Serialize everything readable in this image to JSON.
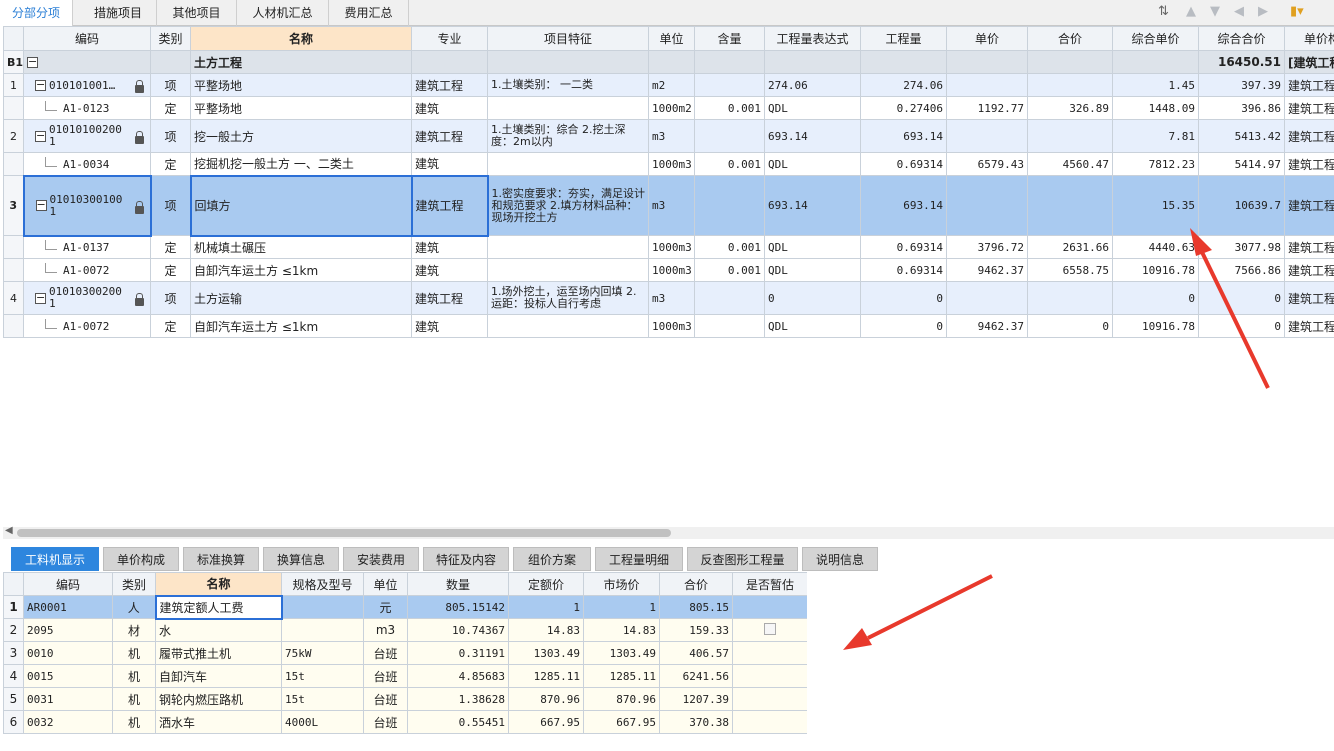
{
  "top_tabs": [
    "分部分项",
    "措施项目",
    "其他项目",
    "人材机汇总",
    "费用汇总"
  ],
  "main_headers": [
    "编码",
    "类别",
    "名称",
    "专业",
    "项目特征",
    "单位",
    "含量",
    "工程量表达式",
    "工程量",
    "单价",
    "合价",
    "综合单价",
    "综合合价",
    "单价构成文"
  ],
  "group_row": {
    "idx": "B1",
    "name": "土方工程",
    "total": "16450.51",
    "spec": "[建筑工程"
  },
  "rows": [
    {
      "type": "item",
      "idx": "1",
      "code": "010101001…",
      "cat": "项",
      "name": "平整场地",
      "major": "建筑工程",
      "feature": "1.土壤类别： 一二类",
      "unit": "m2",
      "content": "",
      "expr": "274.06",
      "qty": "274.06",
      "price": "",
      "sum": "",
      "uprice": "1.45",
      "utotal": "397.39",
      "comp": "建筑工程"
    },
    {
      "type": "sub",
      "idx": "",
      "code": "A1-0123",
      "cat": "定",
      "name": "平整场地",
      "major": "建筑",
      "feature": "",
      "unit": "1000m2",
      "content": "0.001",
      "expr": "QDL",
      "qty": "0.27406",
      "price": "1192.77",
      "sum": "326.89",
      "uprice": "1448.09",
      "utotal": "396.86",
      "comp": "建筑工程"
    },
    {
      "type": "item",
      "idx": "2",
      "code": "01010100200 1",
      "cat": "项",
      "name": "挖一般土方",
      "major": "建筑工程",
      "feature": "1.土壤类别：综合 2.挖土深度：2m以内",
      "unit": "m3",
      "content": "",
      "expr": "693.14",
      "qty": "693.14",
      "price": "",
      "sum": "",
      "uprice": "7.81",
      "utotal": "5413.42",
      "comp": "建筑工程"
    },
    {
      "type": "sub",
      "idx": "",
      "code": "A1-0034",
      "cat": "定",
      "name": "挖掘机挖一般土方 一、二类土",
      "major": "建筑",
      "feature": "",
      "unit": "1000m3",
      "content": "0.001",
      "expr": "QDL",
      "qty": "0.69314",
      "price": "6579.43",
      "sum": "4560.47",
      "uprice": "7812.23",
      "utotal": "5414.97",
      "comp": "建筑工程"
    },
    {
      "type": "sel",
      "idx": "3",
      "code": "01010300100 1",
      "cat": "项",
      "name": "回填方",
      "major": "建筑工程",
      "feature": "1.密实度要求：夯实，满足设计和规范要求 2.填方材料品种：现场开挖土方",
      "unit": "m3",
      "content": "",
      "expr": "693.14",
      "qty": "693.14",
      "price": "",
      "sum": "",
      "uprice": "15.35",
      "utotal": "10639.7",
      "comp": "建筑工程"
    },
    {
      "type": "sub",
      "idx": "",
      "code": "A1-0137",
      "cat": "定",
      "name": "机械填土碾压",
      "major": "建筑",
      "feature": "",
      "unit": "1000m3",
      "content": "0.001",
      "expr": "QDL",
      "qty": "0.69314",
      "price": "3796.72",
      "sum": "2631.66",
      "uprice": "4440.63",
      "utotal": "3077.98",
      "comp": "建筑工程"
    },
    {
      "type": "sub",
      "idx": "",
      "code": "A1-0072",
      "cat": "定",
      "name": "自卸汽车运土方 ≤1km",
      "major": "建筑",
      "feature": "",
      "unit": "1000m3",
      "content": "0.001",
      "expr": "QDL",
      "qty": "0.69314",
      "price": "9462.37",
      "sum": "6558.75",
      "uprice": "10916.78",
      "utotal": "7566.86",
      "comp": "建筑工程"
    },
    {
      "type": "item",
      "idx": "4",
      "code": "01010300200 1",
      "cat": "项",
      "name": "土方运输",
      "major": "建筑工程",
      "feature": "1.场外挖土，运至场内回填 2.运距：投标人自行考虑",
      "unit": "m3",
      "content": "",
      "expr": "0",
      "qty": "0",
      "price": "",
      "sum": "",
      "uprice": "0",
      "utotal": "0",
      "comp": "建筑工程"
    },
    {
      "type": "sub",
      "idx": "",
      "code": "A1-0072",
      "cat": "定",
      "name": "自卸汽车运土方 ≤1km",
      "major": "建筑",
      "feature": "",
      "unit": "1000m3",
      "content": "",
      "expr": "QDL",
      "qty": "0",
      "price": "9462.37",
      "sum": "0",
      "uprice": "10916.78",
      "utotal": "0",
      "comp": "建筑工程"
    }
  ],
  "bottom_tabs": [
    "工料机显示",
    "单价构成",
    "标准换算",
    "换算信息",
    "安装费用",
    "特征及内容",
    "组价方案",
    "工程量明细",
    "反查图形工程量",
    "说明信息"
  ],
  "detail_headers": [
    "编码",
    "类别",
    "名称",
    "规格及型号",
    "单位",
    "数量",
    "定额价",
    "市场价",
    "合价",
    "是否暂估"
  ],
  "detail_rows": [
    {
      "idx": "1",
      "code": "AR0001",
      "cat": "人",
      "name": "建筑定额人工费",
      "spec": "",
      "unit": "元",
      "qty": "805.15142",
      "quota": "1",
      "market": "1",
      "total": "805.15"
    },
    {
      "idx": "2",
      "code": "2095",
      "cat": "材",
      "name": "水",
      "spec": "",
      "unit": "m3",
      "qty": "10.74367",
      "quota": "14.83",
      "market": "14.83",
      "total": "159.33"
    },
    {
      "idx": "3",
      "code": "0010",
      "cat": "机",
      "name": "履带式推土机",
      "spec": "75kW",
      "unit": "台班",
      "qty": "0.31191",
      "quota": "1303.49",
      "market": "1303.49",
      "total": "406.57"
    },
    {
      "idx": "4",
      "code": "0015",
      "cat": "机",
      "name": "自卸汽车",
      "spec": "15t",
      "unit": "台班",
      "qty": "4.85683",
      "quota": "1285.11",
      "market": "1285.11",
      "total": "6241.56"
    },
    {
      "idx": "5",
      "code": "0031",
      "cat": "机",
      "name": "钢轮内燃压路机",
      "spec": "15t",
      "unit": "台班",
      "qty": "1.38628",
      "quota": "870.96",
      "market": "870.96",
      "total": "1207.39"
    },
    {
      "idx": "6",
      "code": "0032",
      "cat": "机",
      "name": "洒水车",
      "spec": "4000L",
      "unit": "台班",
      "qty": "0.55451",
      "quota": "667.95",
      "market": "667.95",
      "total": "370.38"
    }
  ],
  "annotation_color": "#e8392c"
}
